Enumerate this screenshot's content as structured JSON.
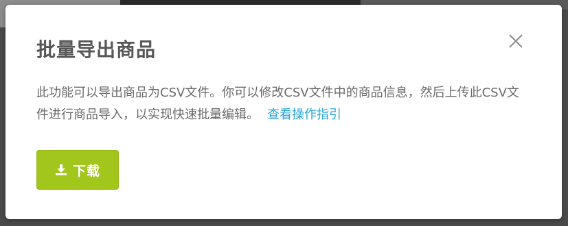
{
  "modal": {
    "title": "批量导出商品",
    "description": "此功能可以导出商品为CSV文件。你可以修改CSV文件中的商品信息，然后上传此CSV文件进行商品导入，以实现快速批量编辑。",
    "guide_link": "查看操作指引",
    "download_label": "下载"
  },
  "icons": {
    "close": "close-icon",
    "download": "download-icon"
  },
  "colors": {
    "accent": "#a3c61c",
    "link": "#2ba6d8",
    "title": "#565656",
    "text": "#6a6a6a"
  }
}
